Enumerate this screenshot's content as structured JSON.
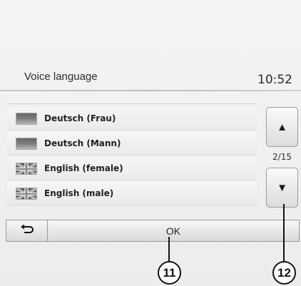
{
  "header": {
    "title": "Voice language",
    "time": "10:52"
  },
  "language_list": {
    "items": [
      {
        "label": "Deutsch (Frau)",
        "flag": "german-flag-icon"
      },
      {
        "label": "Deutsch (Mann)",
        "flag": "german-flag-icon"
      },
      {
        "label": "English (female)",
        "flag": "uk-flag-icon"
      },
      {
        "label": "English (male)",
        "flag": "uk-flag-icon"
      }
    ]
  },
  "scroll": {
    "up_icon": "▲",
    "down_icon": "▼",
    "page_indicator": "2/15"
  },
  "footer": {
    "back_icon": "back-arrow-icon",
    "ok_label": "OK"
  },
  "callouts": {
    "ok": "11",
    "scroll_down": "12"
  }
}
